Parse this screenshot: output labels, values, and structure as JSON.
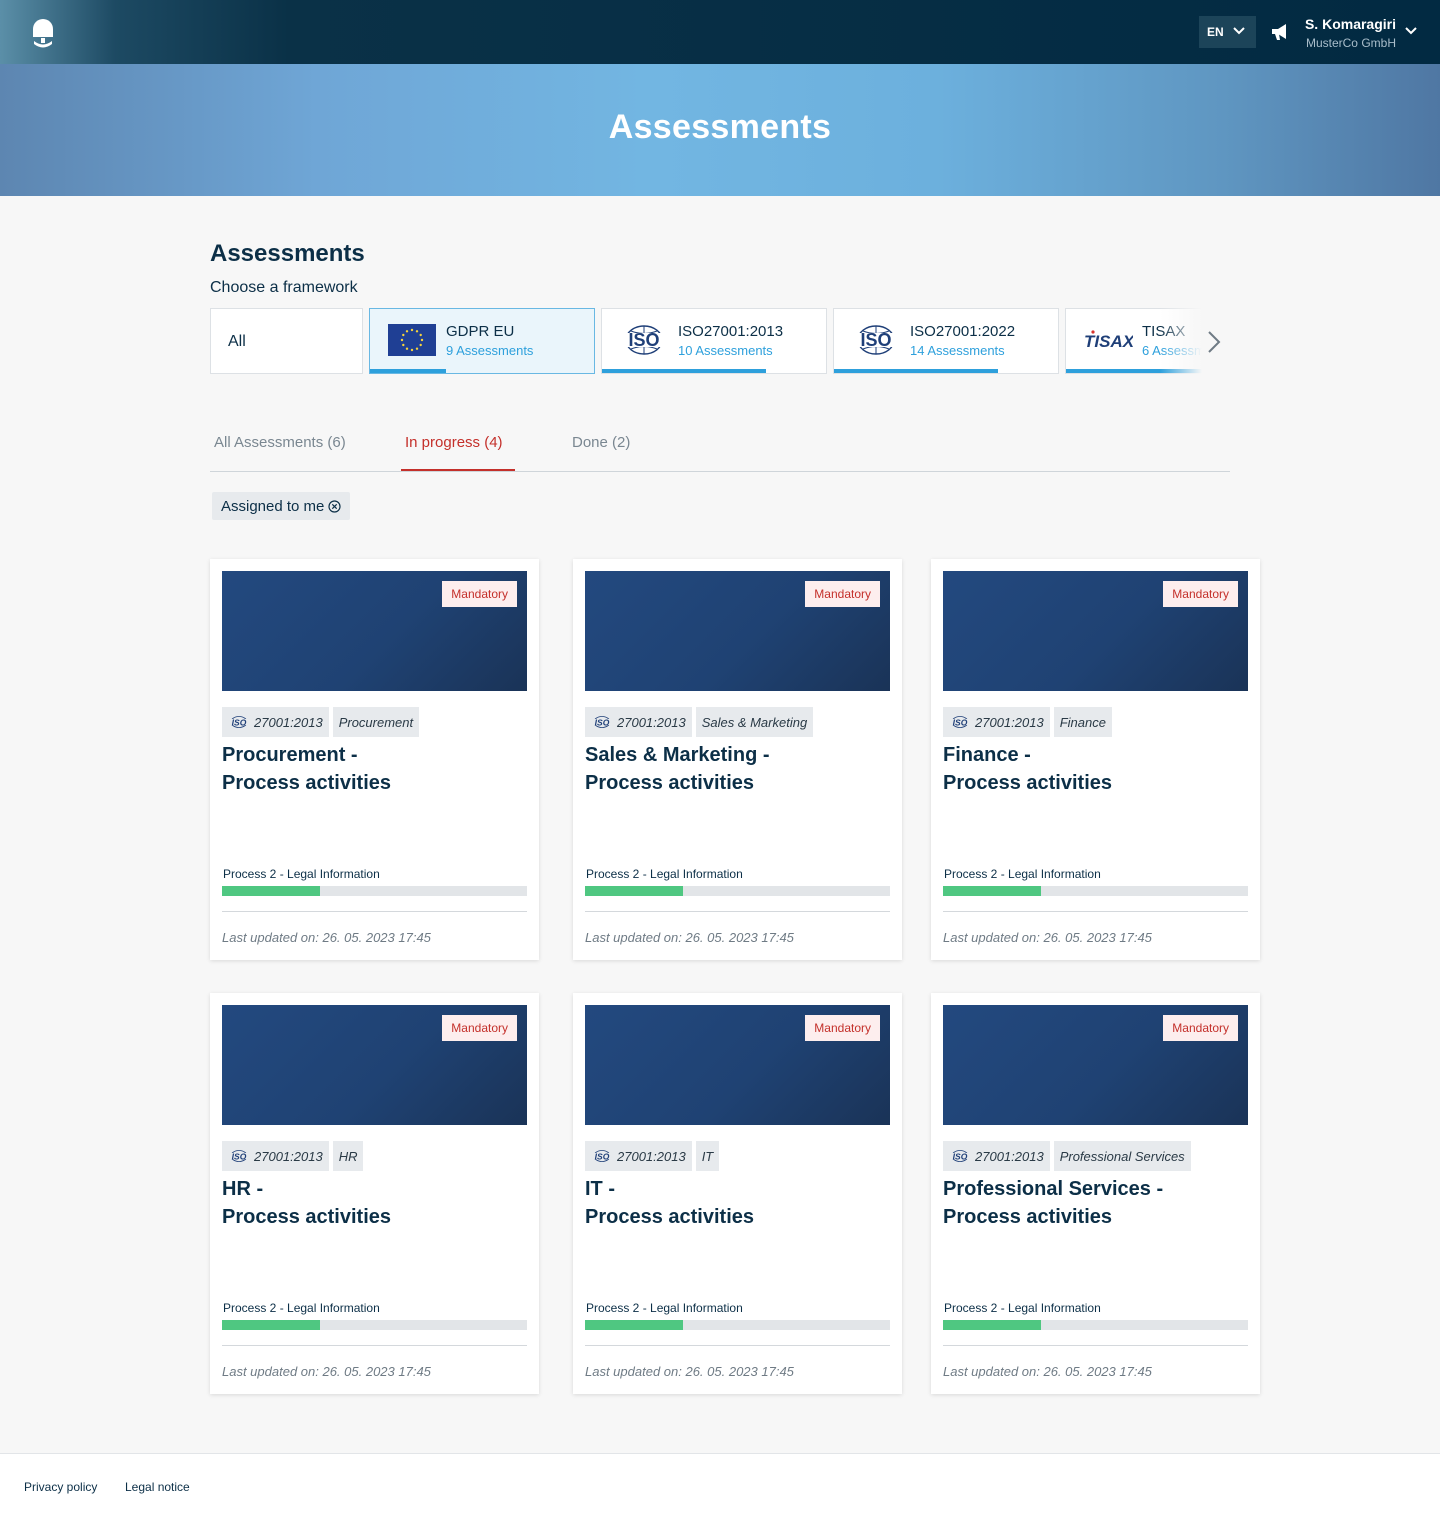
{
  "header": {
    "language": "EN",
    "user_name": "S. Komaragiri",
    "user_org": "MusterCo GmbH"
  },
  "hero": {
    "title": "Assessments"
  },
  "section": {
    "title": "Assessments",
    "subtitle": "Choose a framework"
  },
  "frameworks": [
    {
      "name": "All"
    },
    {
      "name": "GDPR EU",
      "count": "9 Assessments",
      "progress": 0.34,
      "logo": "eu-flag-icon"
    },
    {
      "name": "ISO27001:2013",
      "count": "10 Assessments",
      "progress": 0.73,
      "logo": "iso-logo-icon"
    },
    {
      "name": "ISO27001:2022",
      "count": "14 Assessments",
      "progress": 0.73,
      "logo": "iso-logo-icon"
    },
    {
      "name": "TISAX",
      "count": "6 Assessments",
      "progress": 0.73,
      "logo": "tisax-logo-icon"
    }
  ],
  "tabs": [
    {
      "label": "All Assessments (6)"
    },
    {
      "label": "In progress (4)"
    },
    {
      "label": "Done (2)"
    }
  ],
  "filter_chip": {
    "label": "Assigned to me"
  },
  "cards": [
    {
      "badge": "Mandatory",
      "framework_tag": "27001:2013",
      "department_tag": "Procurement",
      "title_line1": "Procurement -",
      "title_line2": "Process activities",
      "process_label": "Process 2 - Legal Information",
      "progress": 0.32,
      "updated": "Last updated on: 26. 05. 2023 17:45"
    },
    {
      "badge": "Mandatory",
      "framework_tag": "27001:2013",
      "department_tag": "Sales & Marketing",
      "title_line1": "Sales & Marketing -",
      "title_line2": "Process activities",
      "process_label": "Process 2 - Legal Information",
      "progress": 0.32,
      "updated": "Last updated on: 26. 05. 2023 17:45"
    },
    {
      "badge": "Mandatory",
      "framework_tag": "27001:2013",
      "department_tag": "Finance",
      "title_line1": "Finance -",
      "title_line2": "Process activities",
      "process_label": "Process 2 - Legal Information",
      "progress": 0.32,
      "updated": "Last updated on: 26. 05. 2023 17:45"
    },
    {
      "badge": "Mandatory",
      "framework_tag": "27001:2013",
      "department_tag": "HR",
      "title_line1": "HR -",
      "title_line2": "Process activities",
      "process_label": "Process 2 - Legal Information",
      "progress": 0.32,
      "updated": "Last updated on: 26. 05. 2023 17:45"
    },
    {
      "badge": "Mandatory",
      "framework_tag": "27001:2013",
      "department_tag": "IT",
      "title_line1": "IT -",
      "title_line2": "Process activities",
      "process_label": "Process 2 - Legal Information",
      "progress": 0.32,
      "updated": "Last updated on: 26. 05. 2023 17:45"
    },
    {
      "badge": "Mandatory",
      "framework_tag": "27001:2013",
      "department_tag": "Professional Services",
      "title_line1": "Professional Services -",
      "title_line2": "Process activities",
      "process_label": "Process 2 - Legal Information",
      "progress": 0.32,
      "updated": "Last updated on: 26. 05. 2023 17:45"
    }
  ],
  "footer": {
    "privacy": "Privacy policy",
    "legal": "Legal notice"
  },
  "colors": {
    "accent_blue": "#2ea0dc",
    "accent_red": "#c4302b",
    "progress_green": "#4fc781",
    "navy": "#0c2f47"
  }
}
